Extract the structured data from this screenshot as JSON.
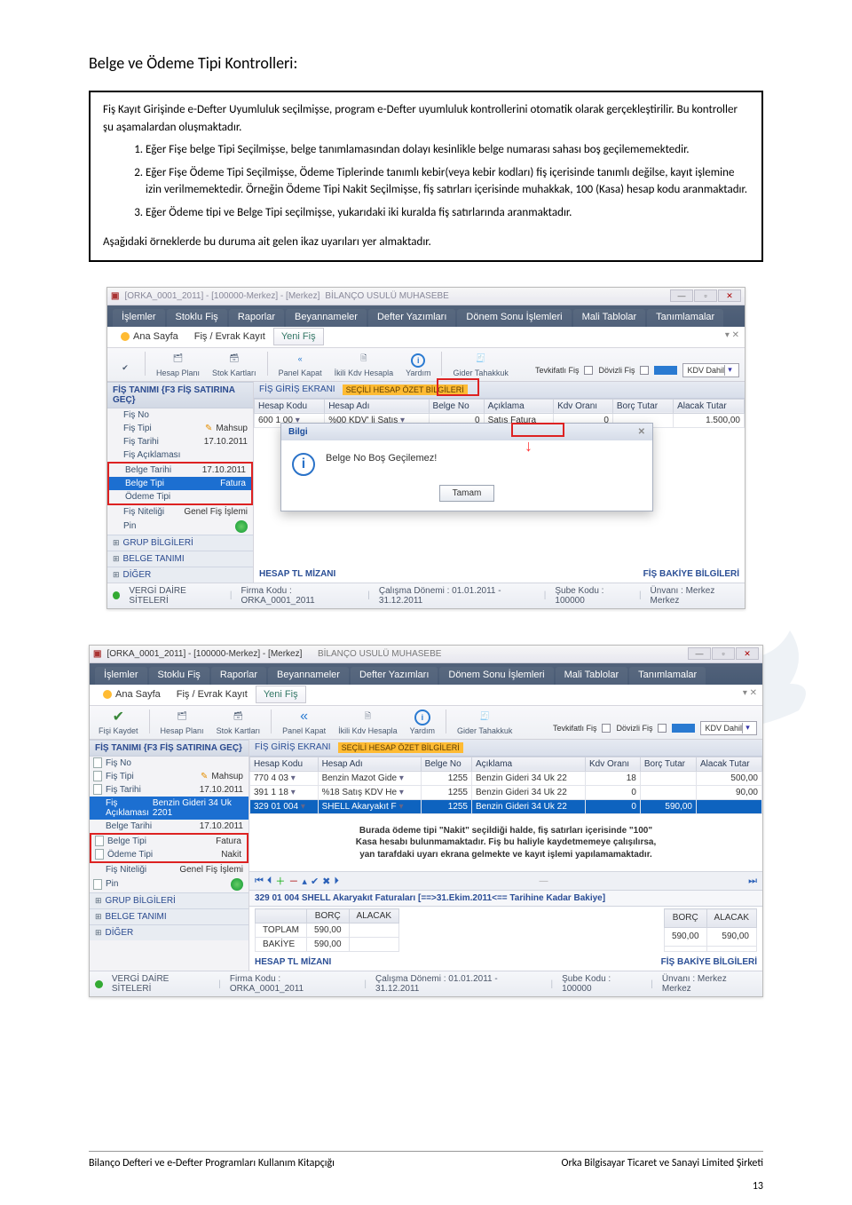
{
  "page": {
    "heading": "Belge ve Ödeme Tipi Kontrolleri:",
    "intro_p1": "Fiş Kayıt Girişinde e-Defter Uyumluluk seçilmişse, program e-Defter uyumluluk kontrollerini otomatik olarak gerçekleştirilir. Bu kontroller şu aşamalardan oluşmaktadır.",
    "list": {
      "i1": "Eğer Fişe belge Tipi Seçilmişse, belge tanımlamasından dolayı kesinlikle belge numarası sahası boş geçilememektedir.",
      "i2": "Eğer Fişe Ödeme Tipi Seçilmişse, Ödeme Tiplerinde tanımlı kebir(veya kebir kodları) fiş içerisinde tanımlı değilse, kayıt işlemine izin verilmemektedir. Örneğin Ödeme Tipi Nakit Seçilmişse, fiş satırları içerisinde muhakkak, 100 (Kasa) hesap kodu aranmaktadır.",
      "i3": "Eğer Ödeme tipi ve Belge Tipi seçilmişse, yukarıdaki iki kuralda fiş satırlarında aranmaktadır."
    },
    "intro_p2": "Aşağıdaki örneklerde bu duruma ait gelen ikaz uyarıları yer almaktadır."
  },
  "app_common": {
    "title_prefix": "[ORKA_0001_2011]  -  [100000-Merkez]  -  [Merkez]",
    "title_suffix": "BİLANÇO USULÜ MUHASEBE",
    "menus": {
      "islemler": "İşlemler",
      "stoklu": "Stoklu Fiş",
      "raporlar": "Raporlar",
      "beyan": "Beyannameler",
      "defter": "Defter Yazımları",
      "donem": "Dönem Sonu İşlemleri",
      "mali": "Mali Tablolar",
      "tanim": "Tanımlamalar"
    },
    "subtabs": {
      "ana": "Ana Sayfa",
      "fisevrak": "Fiş / Evrak Kayıt",
      "yenifis": "Yeni Fiş"
    },
    "toolbar": {
      "fisi": "Fişi Kaydet",
      "hesap": "Hesap Planı",
      "stok": "Stok Kartları",
      "panel": "Panel Kapat",
      "ikili": "İkili Kdv Hesapla",
      "yardim": "Yardım",
      "gider": "Gider Tahakkuk",
      "tevkifat": "Tevkifatlı Fiş",
      "dovizli": "Dövizli Fiş",
      "kdvd": "KDV Dahil"
    },
    "panel_head_left": "FİŞ GİRİŞ EKRANI",
    "panel_head_right": "SEÇİLİ HESAP ÖZET BİLGİLERİ",
    "grid_headers": {
      "hesapkodu": "Hesap Kodu",
      "hesapadi": "Hesap Adı",
      "belgeno": "Belge No",
      "aciklama": "Açıklama",
      "kdvorani": "Kdv Oranı",
      "borctutar": "Borç Tutar",
      "alacaktutar": "Alacak Tutar"
    },
    "mizan": "HESAP TL MİZANI",
    "bakiye": "FİŞ BAKİYE BİLGİLERİ",
    "status": {
      "vergi": "VERGİ DAİRE SİTELERİ",
      "firma_l": "Firma Kodu :",
      "firma_v": "ORKA_0001_2011",
      "calisma_l": "Çalışma Dönemi :",
      "calisma_v": "01.01.2011 - 31.12.2011",
      "sube_l": "Şube Kodu :",
      "sube_v": "100000",
      "unvan_l": "Ünvanı :",
      "unvan_v": "Merkez Merkez"
    }
  },
  "fig1": {
    "side_head": "FİŞ TANIMI  {F3 FİŞ SATIRINA GEÇ}",
    "rows": {
      "fisno_l": "Fiş No",
      "fistipi_l": "Fiş Tipi",
      "fistipi_v": "Mahsup",
      "fistarihi_l": "Fiş Tarihi",
      "fistarihi_v": "17.10.2011",
      "fisacik_l": "Fiş Açıklaması",
      "belgetarihi_l": "Belge Tarihi",
      "belgetarihi_v": "17.10.2011",
      "belgetipi_l": "Belge Tipi",
      "belgetipi_v": "Fatura",
      "odemetipi_l": "Ödeme Tipi",
      "fisnitelik_l": "Fiş Niteliği",
      "fisnitelik_v": "Genel Fiş İşlemi",
      "pin_l": "Pin"
    },
    "collapsers": {
      "grup": "GRUP BİLGİLERİ",
      "belge": "BELGE TANIMI",
      "diger": "DİĞER"
    },
    "gridrow": {
      "hesapkodu": "600 1 00",
      "hesapadi": "%00 KDV' li Satış",
      "belgeno": "0",
      "aciklama": "Satış Fatura",
      "kdvorani": "0",
      "alacak": "1.500,00"
    },
    "dialog": {
      "title": "Bilgi",
      "msg": "Belge No Boş Geçilemez!",
      "btn": "Tamam"
    }
  },
  "fig2": {
    "side_head": "FİŞ TANIMI  {F3 FİŞ SATIRINA GEÇ}",
    "rows": {
      "fisno_l": "Fiş No",
      "fistipi_l": "Fiş Tipi",
      "fistipi_v": "Mahsup",
      "fistarihi_l": "Fiş Tarihi",
      "fistarihi_v": "17.10.2011",
      "fisacik_l": "Fiş Açıklaması",
      "fisacik_v": "Benzin Gideri 34 Uk 2201",
      "belgetarihi_l": "Belge Tarihi",
      "belgetarihi_v": "17.10.2011",
      "belgetipi_l": "Belge Tipi",
      "belgetipi_v": "Fatura",
      "odemetipi_l": "Ödeme Tipi",
      "odemetipi_v": "Nakit",
      "fisnitelik_l": "Fiş Niteliği",
      "fisnitelik_v": "Genel Fiş İşlemi",
      "pin_l": "Pin"
    },
    "collapsers": {
      "grup": "GRUP BİLGİLERİ",
      "belge": "BELGE TANIMI",
      "diger": "DİĞER"
    },
    "grid": [
      {
        "hesapkodu": "770 4 03",
        "hesapadi": "Benzin Mazot Gide",
        "belgeno": "1255",
        "aciklama": "Benzin Gideri 34 Uk 22",
        "kdv": "18",
        "borc": "",
        "alacak": "500,00"
      },
      {
        "hesapkodu": "391 1 18",
        "hesapadi": "%18 Satış KDV He",
        "belgeno": "1255",
        "aciklama": "Benzin Gideri 34 Uk 22",
        "kdv": "0",
        "borc": "",
        "alacak": "90,00"
      },
      {
        "hesapkodu": "329 01 004",
        "hesapadi": "SHELL Akaryakıt F",
        "belgeno": "1255",
        "aciklama": "Benzin Gideri 34 Uk 22",
        "kdv": "0",
        "borc": "590,00",
        "alacak": ""
      }
    ],
    "callout": {
      "l1": "Burada ödeme tipi \"Nakit\" seçildiği halde, fiş satırları içerisinde \"100\"",
      "l2": "Kasa hesabı bulunmamaktadır. Fiş bu haliyle kaydetmemeye çalışılırsa,",
      "l3": "yan tarafdaki uyarı ekrana gelmekte ve kayıt işlemi yapılamamaktadır."
    },
    "account_line": "329 01 004   SHELL Akaryakıt Faturaları [==>31.Ekim.2011<== Tarihine Kadar Bakiye]",
    "balance": {
      "borc_h": "BORÇ",
      "alacak_h": "ALACAK",
      "toplam_l": "TOPLAM",
      "toplam": "590,00",
      "bakiye_l": "BAKİYE",
      "bakiye": "590,00",
      "r_borc": "590,00",
      "r_alacak": "590,00"
    }
  },
  "footer": {
    "left": "Bilanço Defteri ve e-Defter Programları Kullanım Kitapçığı",
    "right": "Orka Bilgisayar Ticaret ve Sanayi Limited Şirketi",
    "page": "13"
  }
}
